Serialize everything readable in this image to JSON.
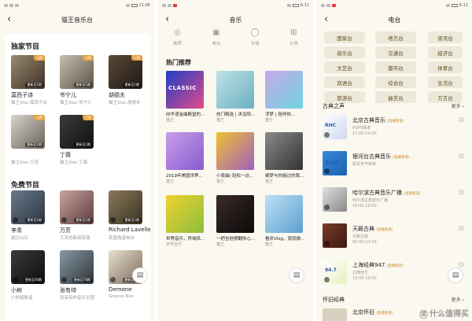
{
  "status": {
    "left_time": "11:06",
    "mid_time": "6:11",
    "right_time": "6:11"
  },
  "screen1": {
    "title": "猫王音乐台",
    "exclusive_title": "独家节目",
    "free_title": "免费节目",
    "paid_badge": "付费",
    "exclusive": [
      {
        "name": "莫西子诗",
        "sub": "猫王Star:莫西子诗",
        "upd": "更新至1期",
        "bg": "linear-gradient(135deg,#9a8a70,#3d3126)"
      },
      {
        "name": "爷宁儿",
        "sub": "猫王Star:爷宁儿",
        "upd": "更新至1期",
        "bg": "linear-gradient(135deg,#c7c0b0,#5a5246)"
      },
      {
        "name": "胡德夫",
        "sub": "猫王Star:胡德夫",
        "upd": "更新至1期",
        "bg": "linear-gradient(135deg,#5a4838,#1f1914)"
      },
      {
        "name": "",
        "sub": "猫王Star:万芳",
        "upd": "更新至1期",
        "bg": "linear-gradient(135deg,#d8d4cc,#6a6258)"
      },
      {
        "name": "丁薇",
        "sub": "猫王Star:丁薇",
        "upd": "更新至1期",
        "bg": "linear-gradient(135deg,#3a3a3a,#111)"
      }
    ],
    "free": [
      {
        "name": "李青",
        "sub": "越过山丘",
        "upd": "更新至1期",
        "bg": "linear-gradient(135deg,#6a7a8a,#2a3440)"
      },
      {
        "name": "万芳",
        "sub": "万芳的新闻部落",
        "upd": "更新至1期",
        "bg": "linear-gradient(135deg,#caa3a0,#5a3b3a)"
      },
      {
        "name": "Richard Lavelle",
        "sub": "英国海盗电台",
        "upd": "更新至1期",
        "bg": "linear-gradient(135deg,#8a7a5a,#3a3222)"
      },
      {
        "name": "小树",
        "sub": "小树摇歌谣",
        "upd": "更新至40期",
        "bg": "linear-gradient(135deg,#3a3a3a,#0d0d0d)"
      },
      {
        "name": "张有待",
        "sub": "张有待的音乐乐园",
        "upd": "更新至78期",
        "bg": "linear-gradient(135deg,#8a9aa5,#2c3338)"
      },
      {
        "name": "Demone",
        "sub": "Groove Box",
        "upd": "更新至1期",
        "bg": "linear-gradient(135deg,#e8e0d0,#7a6a5a)"
      }
    ]
  },
  "screen2": {
    "title": "音乐",
    "nav": [
      {
        "label": "推荐",
        "icon": "◎"
      },
      {
        "label": "电台",
        "icon": "▣"
      },
      {
        "label": "专辑",
        "icon": "◯"
      },
      {
        "label": "分类",
        "icon": "⊞"
      }
    ],
    "hot_title": "热门推荐",
    "albums": [
      {
        "name": "向华语金曲殿堂的...",
        "sub": "猫王",
        "art": "CLASSIC",
        "bg": "linear-gradient(135deg,#1c3fc6,#e54a8a)"
      },
      {
        "name": "热门精选 | 沐浴阳...",
        "sub": "猫王",
        "art": "",
        "bg": "linear-gradient(135deg,#bfe2e8,#6ab0c0)"
      },
      {
        "name": "浮梦 | 陪伴你...",
        "sub": "猫王",
        "art": "",
        "bg": "linear-gradient(135deg,#c7a9e8,#6fd3e0)"
      },
      {
        "name": "2019年美国世界...",
        "sub": "猫王",
        "art": "",
        "bg": "linear-gradient(135deg,#c7a0e8,#8a5ad0)"
      },
      {
        "name": "小夜曲| 轻松一达...",
        "sub": "猫王",
        "art": "",
        "bg": "linear-gradient(135deg,#f0c030,#a060c0)"
      },
      {
        "name": "细梦与你能过的周...",
        "sub": "猫王",
        "art": "",
        "bg": "linear-gradient(135deg,#8a8a8a,#333)"
      },
      {
        "name": "世界音乐，异域风...",
        "sub": "世界音乐",
        "art": "",
        "bg": "linear-gradient(135deg,#f2d033,#8ac03a)"
      },
      {
        "name": "一把吉他撩翻你心...",
        "sub": "猫王",
        "art": "",
        "bg": "linear-gradient(135deg,#3a2a2a,#0c0a0a)"
      },
      {
        "name": "看厌Vlog，就就做...",
        "sub": "猫王",
        "art": "",
        "bg": "linear-gradient(135deg,#bfe0f5,#5aa0d0)"
      }
    ]
  },
  "screen3": {
    "title": "电台",
    "chips": [
      "国家台",
      "地方台",
      "资讯台",
      "音乐台",
      "交通台",
      "经济台",
      "文艺台",
      "都市台",
      "体育台",
      "双语台",
      "综合台",
      "生活台",
      "旅游台",
      "曲艺台",
      "方言台"
    ],
    "classic_title": "古典之声",
    "more": "更多",
    "stations": [
      {
        "name": "北京古典音乐",
        "tag": "(直播频道)",
        "desc": "POPS频率",
        "desc2": "17:00-19:00",
        "bg": "linear-gradient(135deg,#ffffff,#d0d8f0)",
        "logo": "RHC"
      },
      {
        "name": "银河台古典音乐",
        "tag": "(直播频道)",
        "desc": "股票天气频率",
        "desc2": "",
        "bg": "linear-gradient(135deg,#3a8ad8,#1b5fb0)",
        "logo": "银河台"
      },
      {
        "name": "哈尔滨古典音乐广播",
        "tag": "(直播频道)",
        "desc": "哈尔滨古典音乐广播",
        "desc2": "18:00-19:00",
        "bg": "linear-gradient(135deg,#e0e0e0,#888)",
        "logo": ""
      },
      {
        "name": "天籁古典",
        "tag": "(直播频道)",
        "desc": "天籁古典",
        "desc2": "00:00-23:59",
        "bg": "linear-gradient(135deg,#7a3a2a,#3a1a12)",
        "logo": ""
      },
      {
        "name": "上海经典947",
        "tag": "(直播频道)",
        "desc": "古典音乐",
        "desc2": "18:00-19:00",
        "bg": "linear-gradient(135deg,#ffffff,#e8f0c0)",
        "logo": "94.7"
      }
    ],
    "nostalgia_title": "怀旧经典",
    "nostalgia_first": "北京怀旧",
    "nostalgia_tag": "(直播频道)"
  },
  "watermark": "什么值得买"
}
